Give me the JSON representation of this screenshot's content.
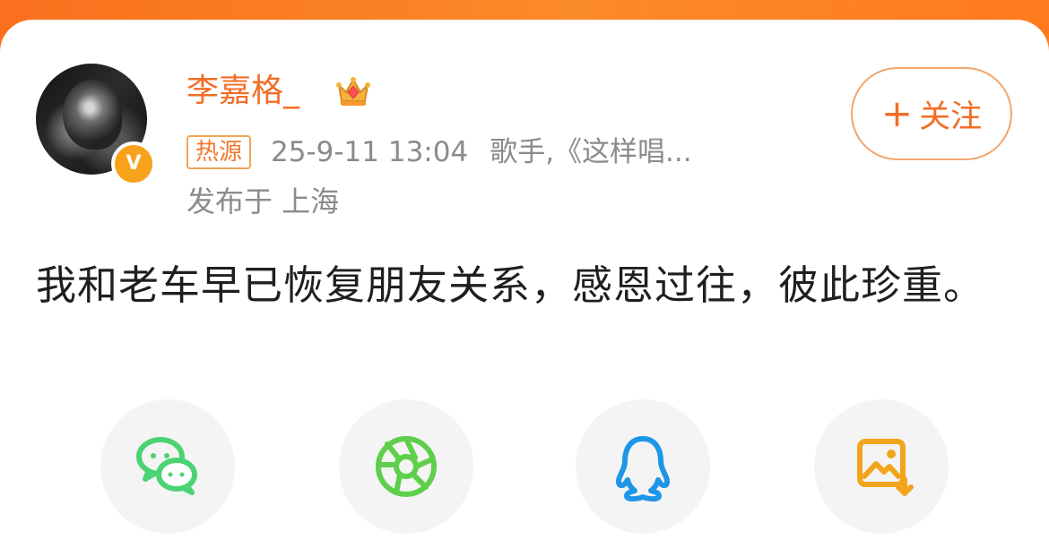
{
  "profile": {
    "name": "李嘉格_",
    "verified_icon": "orange-v-icon",
    "crown_icon": "crown-icon"
  },
  "meta": {
    "hot_label": "热源",
    "timestamp": "25-9-11 13:04",
    "description": "歌手,《这样唱...",
    "location": "发布于 上海"
  },
  "actions": {
    "follow_label": "关注",
    "follow_icon": "plus-icon"
  },
  "post": {
    "text": "我和老车早已恢复朋友关系，感恩过往，彼此珍重。"
  },
  "share": [
    {
      "name": "wechat-icon"
    },
    {
      "name": "moments-icon"
    },
    {
      "name": "qq-icon"
    },
    {
      "name": "save-image-icon"
    }
  ],
  "colors": {
    "header_orange": "#f97822",
    "accent_orange": "#f36d26",
    "gray_text": "#8b8b8b",
    "wechat_green": "#4bd373",
    "moments_green": "#5ecf4b",
    "qq_blue": "#1e96e8",
    "save_orange": "#f2a51c"
  }
}
